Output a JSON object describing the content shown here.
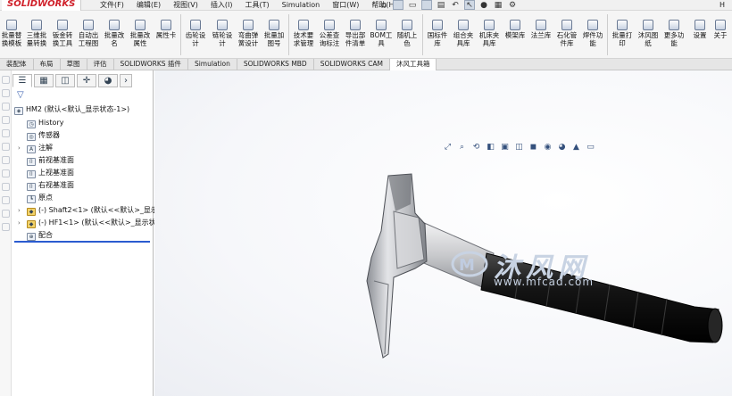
{
  "app": {
    "logo": "SOLIDWORKS"
  },
  "menus": [
    "文件(F)",
    "编辑(E)",
    "视图(V)",
    "插入(I)",
    "工具(T)",
    "Simulation",
    "窗口(W)",
    "帮助(H)"
  ],
  "menubar_right": "H",
  "quick_icons": [
    "home-icon",
    "new-file-icon",
    "open-file-icon",
    "save-icon",
    "print-icon",
    "undo-icon",
    "select-arrow-icon",
    "traffic-light-icon",
    "options-icon",
    "gear-icon"
  ],
  "commands": [
    {
      "label": "批量替换模板",
      "icon": "template-replace-icon"
    },
    {
      "label": "三维批量转换",
      "icon": "batch-convert-icon"
    },
    {
      "label": "钣金转换工具",
      "icon": "sheetmetal-icon"
    },
    {
      "label": "自动出工程图",
      "icon": "drawing-icon"
    },
    {
      "label": "批量改名",
      "icon": "rename-icon"
    },
    {
      "label": "批量改属性",
      "icon": "properties-icon"
    },
    {
      "label": "属性卡",
      "icon": "property-card-icon"
    },
    {
      "label": "齿轮设计",
      "icon": "gear-design-icon"
    },
    {
      "label": "链轮设计",
      "icon": "sprocket-icon"
    },
    {
      "label": "弯曲弹簧设计",
      "icon": "spring-icon"
    },
    {
      "label": "批量加图号",
      "icon": "drawing-number-icon"
    },
    {
      "label": "技术要求管理",
      "icon": "tech-req-icon"
    },
    {
      "label": "公差查询标注",
      "icon": "tolerance-icon"
    },
    {
      "label": "导出部件清单",
      "icon": "bom-export-icon"
    },
    {
      "label": "BOM工具",
      "icon": "bom-tool-icon"
    },
    {
      "label": "随机上色",
      "icon": "random-color-icon"
    },
    {
      "label": "国标件库",
      "icon": "standard-parts-icon"
    },
    {
      "label": "组合夹具库",
      "icon": "fixture-lib-icon"
    },
    {
      "label": "机床夹具库",
      "icon": "machine-fixture-icon"
    },
    {
      "label": "模架库",
      "icon": "mold-base-icon"
    },
    {
      "label": "法兰库",
      "icon": "flange-icon"
    },
    {
      "label": "石化管件库",
      "icon": "pipe-fitting-icon"
    },
    {
      "label": "焊件功能",
      "icon": "weldment-icon"
    },
    {
      "label": "批量打印",
      "icon": "batch-print-icon"
    },
    {
      "label": "沐风图纸",
      "icon": "mufeng-drawings-icon"
    },
    {
      "label": "更多功能",
      "icon": "more-icon"
    },
    {
      "label": "设置",
      "icon": "settings-icon"
    },
    {
      "label": "关于",
      "icon": "about-icon"
    }
  ],
  "tabs": [
    "装配体",
    "布局",
    "草图",
    "评估",
    "SOLIDWORKS 插件",
    "Simulation",
    "SOLIDWORKS MBD",
    "SOLIDWORKS CAM",
    "沐风工具箱"
  ],
  "active_tab": "沐风工具箱",
  "fm_tabs": [
    "feature-manager-icon",
    "property-manager-icon",
    "config-manager-icon",
    "dimxpert-icon",
    "display-manager-icon"
  ],
  "tree": {
    "root": "HM2  (默认<默认_显示状态-1>)",
    "items": [
      {
        "label": "History",
        "icon": "history-icon"
      },
      {
        "label": "传感器",
        "icon": "sensor-icon"
      },
      {
        "label": "注解",
        "icon": "annotation-icon"
      },
      {
        "label": "前视基准面",
        "icon": "plane-icon"
      },
      {
        "label": "上视基准面",
        "icon": "plane-icon"
      },
      {
        "label": "右视基准面",
        "icon": "plane-icon"
      },
      {
        "label": "原点",
        "icon": "origin-icon"
      },
      {
        "label": "(-) Shaft2<1> (默认<<默认>_显示",
        "icon": "part-icon"
      },
      {
        "label": "(-) HF1<1> (默认<<默认>_显示状",
        "icon": "part-icon"
      },
      {
        "label": "配合",
        "icon": "mates-icon"
      }
    ]
  },
  "watermark": {
    "text": "沐风网",
    "url": "www.mfcad.com"
  },
  "colors": {
    "logo_red": "#d0202a",
    "tree_underline": "#2a5bd0",
    "hammer_head": "#b9bbbf",
    "handle": "#1a1a1a"
  }
}
